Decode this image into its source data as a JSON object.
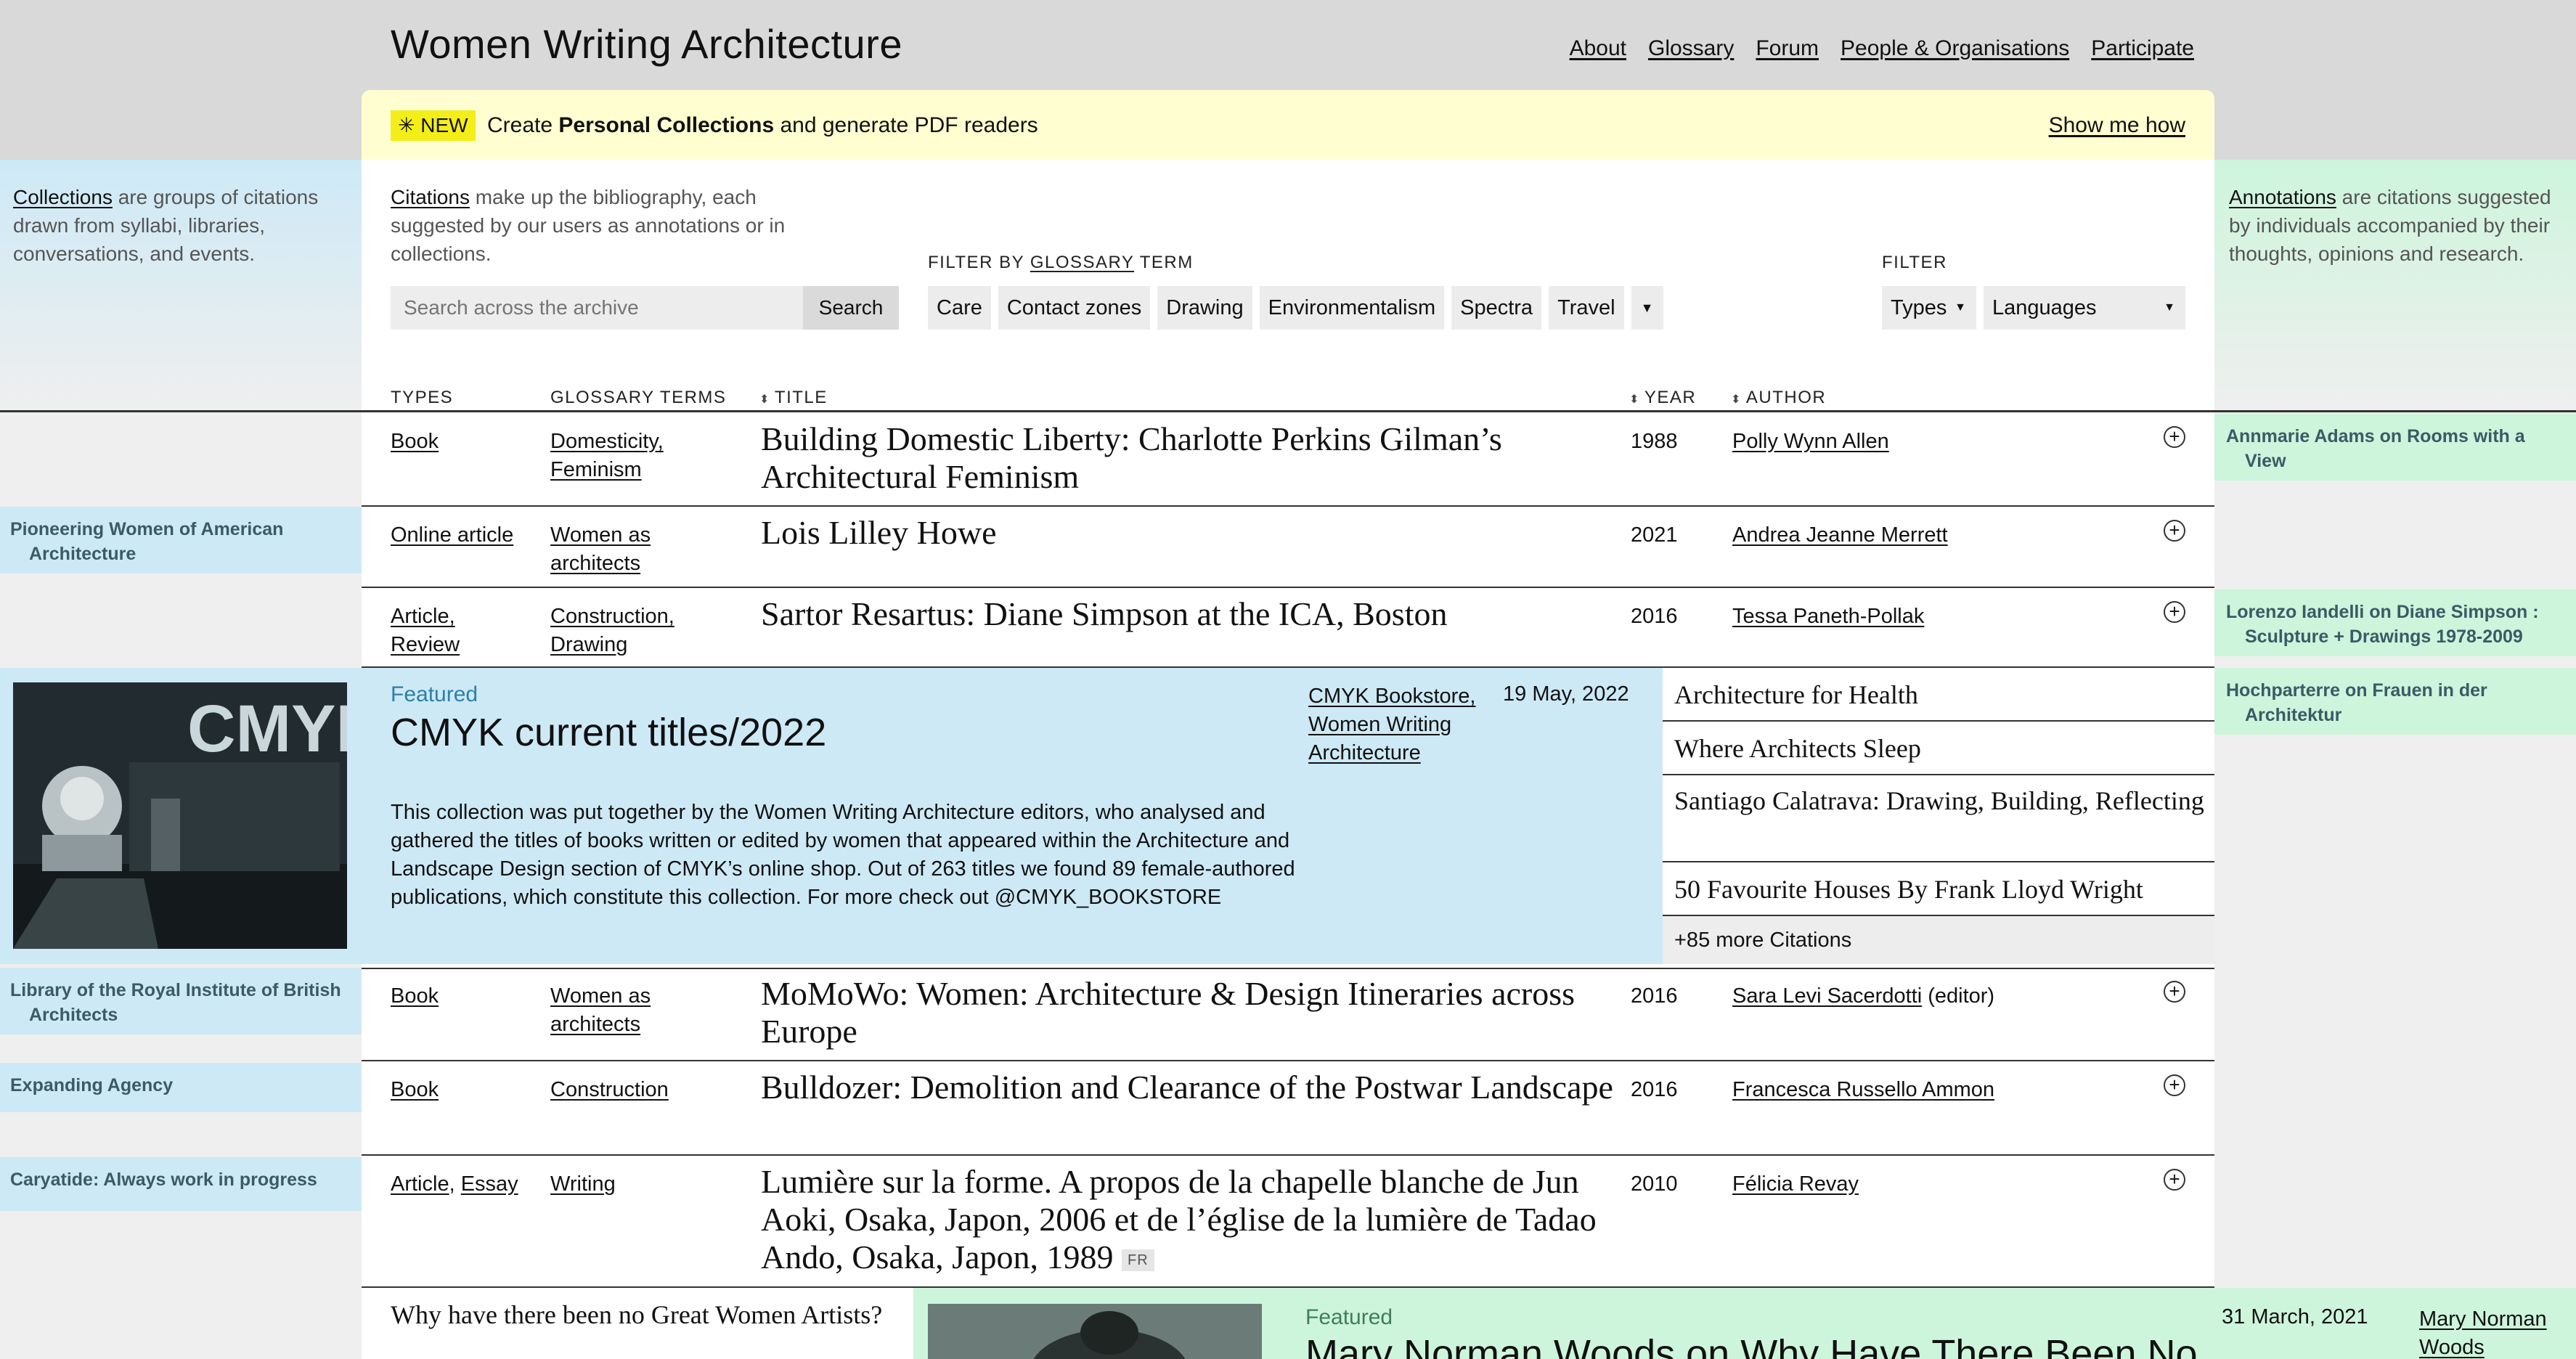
{
  "site": {
    "title": "Women Writing Architecture",
    "nav": [
      "About",
      "Glossary",
      "Forum",
      "People & Organisations",
      "Participate"
    ]
  },
  "banner": {
    "badge": "✳ NEW",
    "text_pre": "Create ",
    "text_bold": "Personal Collections",
    "text_post": " and generate PDF readers",
    "link": "Show me how",
    "color": "#fffed0",
    "badge_color": "#f4ee18"
  },
  "collections_intro": {
    "link": "Collections",
    "text": " are groups of citations drawn from syllabi, libraries, conversations, and events."
  },
  "annotations_intro": {
    "link": "Annotations",
    "text": " are citations suggested by individuals accompanied by their thoughts, opinions and research."
  },
  "citations_intro": {
    "link": "Citations",
    "text": " make up the bibliography, each suggested by our users as annotations or in collections."
  },
  "search": {
    "placeholder": "Search across the archive",
    "button": "Search"
  },
  "filter_glossary": {
    "label_pre": "FILTER BY ",
    "label_link": "GLOSSARY",
    "label_post": " TERM",
    "terms": [
      "Care",
      "Contact zones",
      "Drawing",
      "Environmentalism",
      "Spectra",
      "Travel"
    ]
  },
  "filter": {
    "label": "FILTER",
    "types": "Types",
    "languages": "Languages"
  },
  "table_headers": {
    "types": "TYPES",
    "glossary": "GLOSSARY TERMS",
    "title": "TITLE",
    "year": "YEAR",
    "author": "AUTHOR"
  },
  "rows": [
    {
      "types": "Book",
      "terms_1": "Domesticity,",
      "terms_2": "Feminism",
      "title": "Building Domestic Liberty: Charlotte Perkins Gilman’s Architectural Feminism",
      "year": "1988",
      "author": "Polly Wynn Allen"
    },
    {
      "types": "Online article",
      "terms_1": "Women as",
      "terms_2": "architects",
      "title": "Lois Lilley Howe",
      "year": "2021",
      "author": "Andrea Jeanne Merrett"
    },
    {
      "types_1": "Article,",
      "types_2": "Review",
      "terms_1": "Construction,",
      "terms_2": "Drawing",
      "title": "Sartor Resartus: Diane Simpson at the ICA, Boston",
      "year": "2016",
      "author": "Tessa Paneth-Pollak"
    },
    {
      "types": "Book",
      "terms_1": "Women as",
      "terms_2": "architects",
      "title": "MoMoWo: Women: Architecture & Design Itineraries across Europe",
      "year": "2016",
      "author": "Sara Levi Sacerdotti",
      "author_suffix": "(editor)"
    },
    {
      "types": "Book",
      "terms_1": "Construction",
      "title": "Bulldozer: Demolition and Clearance of the Postwar Landscape",
      "year": "2016",
      "author": "Francesca Russello Ammon"
    },
    {
      "types_1": "Article",
      "types_2": "Essay",
      "terms_1": "Writing",
      "title": "Lumière sur la forme. A propos de la chapelle blanche de Jun Aoki, Osaka, Japon, 2006 et de l’église de la lumière de Tadao Ando, Osaka, Japon, 1989",
      "lang": "FR",
      "year": "2010",
      "author": "Félicia Revay"
    }
  ],
  "featured": {
    "label": "Featured",
    "title": "CMYK current titles/2022",
    "description": "This collection was put together by the Women Writing Architecture editors, who analysed and gathered the titles of books written or edited by women that appeared within the Architecture and Landscape Design section of CMYK’s online shop. Out of 263 titles we found 89 female-authored publications, which constitute this collection. For more check out @CMYK_BOOKSTORE",
    "author_1": "CMYK Bookstore,",
    "author_2": "Women Writing",
    "author_3": "Architecture",
    "date": "19 May, 2022",
    "image_text": "CMYK",
    "citations": [
      "Architecture for Health",
      "Where Architects Sleep",
      "Santiago Calatrava: Drawing, Building, Reflecting",
      "50 Favourite Houses By Frank Lloyd Wright"
    ],
    "more": "+85 more Citations"
  },
  "left_collections": [
    {
      "l1": "Pioneering Women of American",
      "l2": "Architecture"
    },
    {
      "l1": "Library of the Royal Institute of British",
      "l2": "Architects"
    },
    {
      "l1": "Expanding Agency"
    },
    {
      "l1": "Caryatide: Always work in progress"
    }
  ],
  "right_annotations": [
    {
      "l1": "Annmarie Adams on Rooms with a",
      "l2": "View"
    },
    {
      "l1": "Lorenzo Iandelli on Diane Simpson :",
      "l2": "Sculpture + Drawings 1978-2009"
    },
    {
      "l1": "Hochparterre on Frauen in der",
      "l2": "Architektur"
    }
  ],
  "bottom": {
    "title": "Why have there been no Great Women Artists?",
    "featured_label": "Featured",
    "featured_title": "Mary Norman Woods on Why Have There Been No",
    "date": "31 March, 2021",
    "author_1": "Mary Norman",
    "author_2": "Woods"
  },
  "colors": {
    "collections_blue": "#cde9f6",
    "annotations_green": "#cdf5dc",
    "featured_label": "#2d7fa8"
  }
}
